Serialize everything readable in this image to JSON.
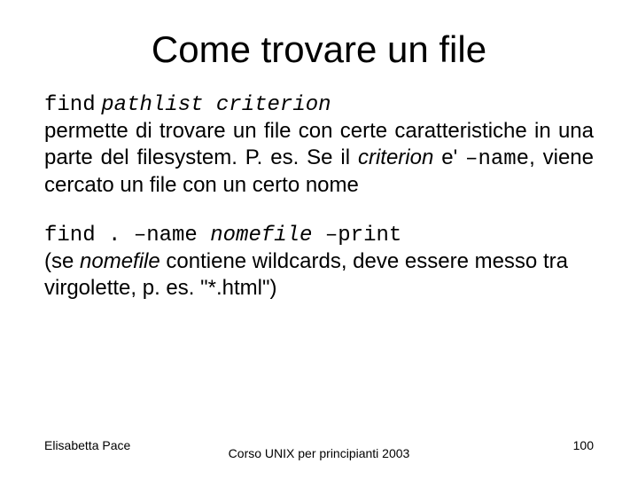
{
  "title": "Come trovare un file",
  "para1": {
    "cmd": "find",
    "args": "pathlist criterion",
    "desc1": "permette di trovare un file con certe caratteristiche in una parte del filesystem. P. es. Se il ",
    "critword": "criterion",
    "desc2": " e' ",
    "flag": "–name",
    "desc3": ", viene cercato un file con un certo nome"
  },
  "para2": {
    "line1a": "find . –name ",
    "line1b": "nomefile",
    "line1c": " –print",
    "line2a": "(se ",
    "line2b": "nomefile",
    "line2c": " contiene wildcards, deve essere messo tra virgolette, p. es. \"*.html\")"
  },
  "footer": {
    "left": "Elisabetta Pace",
    "center": "Corso UNIX per principianti 2003",
    "right": "100"
  }
}
